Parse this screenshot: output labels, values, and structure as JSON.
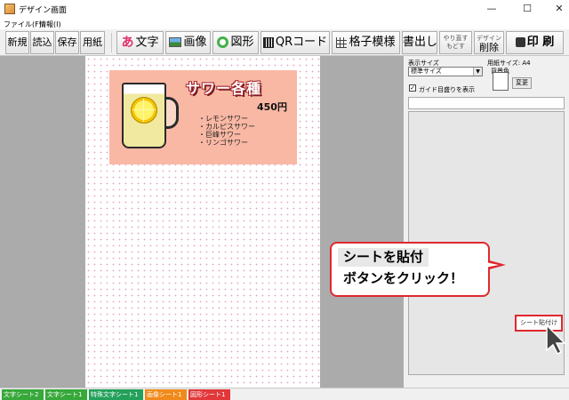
{
  "window": {
    "title": "デザイン画面",
    "minimize": "—",
    "maximize": "☐",
    "close": "✕"
  },
  "menu": {
    "file": "ファイル(F)",
    "info": "情報(I)"
  },
  "toolbar": {
    "new": "新規",
    "open": "読込",
    "save": "保存",
    "paper": "用紙",
    "text": "文字",
    "text_icon": "あ",
    "image": "画像",
    "shape": "図形",
    "qr": "QRコード",
    "grid": "格子模様",
    "export": "書出し",
    "redo_top": "やり直す",
    "redo_bottom": "もどす",
    "delete_top": "デザイン",
    "delete_bottom": "削除",
    "print": "印 刷"
  },
  "card": {
    "title": "サワー各種",
    "price": "450円",
    "items": [
      "レモンサワー",
      "カルピスサワー",
      "巨峰サワー",
      "リンゴサワー"
    ]
  },
  "panel": {
    "display_size_label": "表示サイズ",
    "display_size_value": "標準サイズ",
    "paper_size_label": "用紙サイズ: A4",
    "bg_color_label": "背景色",
    "change_button": "変更",
    "guide_checkbox_label": "ガイド目盛りを表示",
    "guide_checked": true,
    "paste_sheet_button": "シート貼付け"
  },
  "callout": {
    "line1": "シートを貼付",
    "line2": "ボタンをクリック！",
    "border_color": "#e0272e"
  },
  "sheet_tabs": [
    {
      "label": "文字シート2",
      "color": "#37a83a"
    },
    {
      "label": "文字シート1",
      "color": "#37a83a"
    },
    {
      "label": "特殊文字シート1",
      "color": "#23a05a"
    },
    {
      "label": "画像シート1",
      "color": "#f08a1a"
    },
    {
      "label": "図形シート1",
      "color": "#e2383a"
    }
  ]
}
